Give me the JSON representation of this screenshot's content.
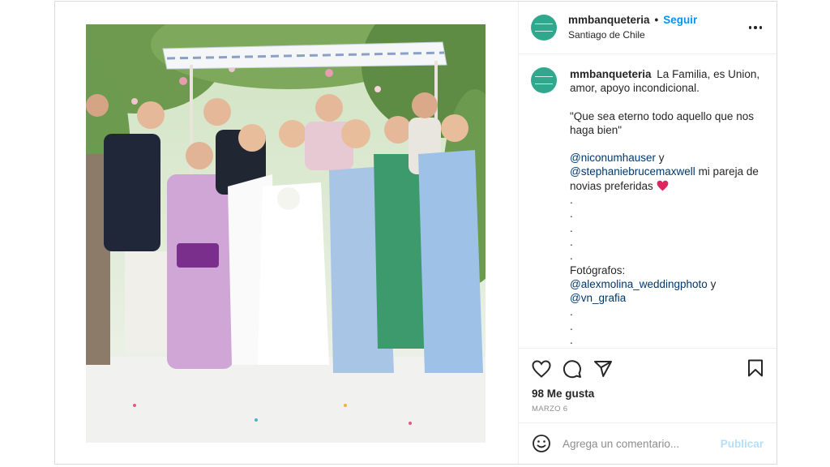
{
  "post": {
    "account": {
      "username": "mmbanqueteria",
      "separator": "•",
      "follow_label": "Seguir",
      "location": "Santiago de Chile"
    },
    "caption": {
      "username": "mmbanqueteria",
      "line1": "La Familia, es Union, amor, apoyo incondicional.",
      "quote": "\"Que sea eterno todo aquello que nos haga bien\"",
      "mention1": "@niconumhauser",
      "and1": "y",
      "mention2": "@stephaniebrucemaxwell",
      "after_mention2": "mi pareja de novias preferidas",
      "dots": [
        ".",
        ".",
        ".",
        ".",
        "."
      ],
      "photographers_label": "Fotógrafos:",
      "mention3": "@alexmolina_weddingphoto",
      "and2": "y",
      "mention4": "@vn_grafia",
      "dots2": [
        ".",
        ".",
        "."
      ]
    },
    "likes": "98 Me gusta",
    "date": "MARZO 6",
    "comment_placeholder": "Agrega un comentario...",
    "publish_label": "Publicar",
    "colors": {
      "link": "#0095f6",
      "mention": "#00376b",
      "avatar": "#2fa88e",
      "heart_emoji": "#e0245e"
    },
    "icons": [
      "more-options-icon",
      "heart-icon",
      "comment-icon",
      "share-icon",
      "bookmark-icon",
      "emoji-icon",
      "red-heart-emoji"
    ]
  }
}
